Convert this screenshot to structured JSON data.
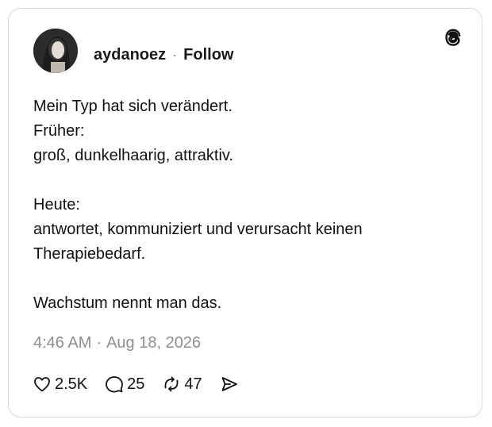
{
  "post": {
    "author": {
      "username": "aydanoez",
      "separator": "·",
      "follow_label": "Follow"
    },
    "body_lines": [
      "Mein Typ hat sich verändert.",
      "Früher:",
      "groß, dunkelhaarig, attraktiv.",
      "",
      "Heute:",
      "antwortet, kommuniziert und verursacht keinen",
      "Therapiebedarf.",
      "",
      "Wachstum nennt man das."
    ],
    "time": "4:46 AM",
    "date_separator": "·",
    "date": "Aug 18, 2026",
    "stats": {
      "likes": "2.5K",
      "replies": "25",
      "reposts": "47"
    }
  },
  "icons": {
    "logo": "threads-logo-icon",
    "like": "heart-icon",
    "reply": "speech-bubble-icon",
    "repost": "repost-icon",
    "share": "send-icon"
  },
  "colors": {
    "text": "#111111",
    "muted": "#8e8e8e",
    "border": "#d9d9d9"
  }
}
